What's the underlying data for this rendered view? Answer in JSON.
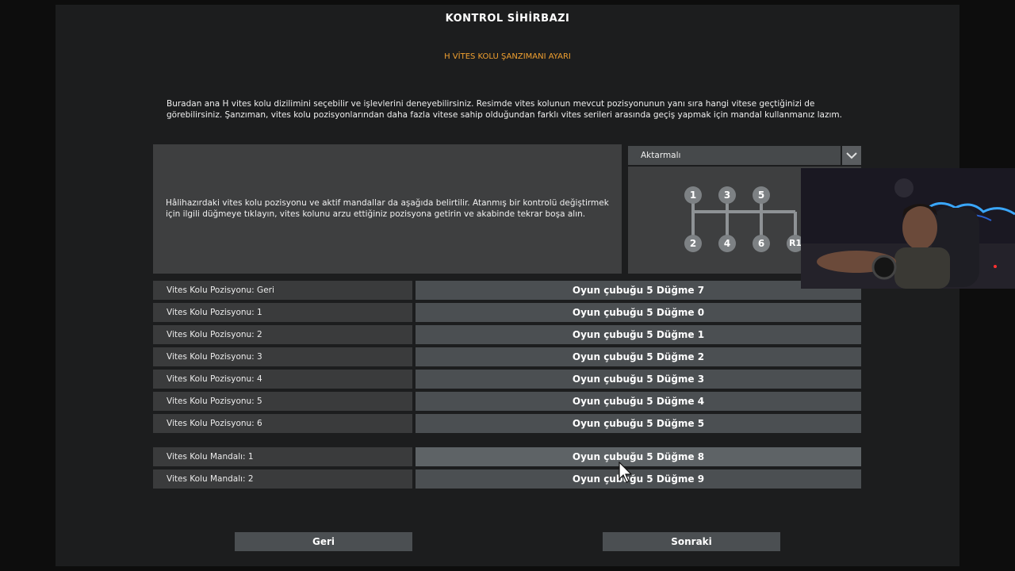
{
  "header": {
    "title": "KONTROL SİHİRBAZI",
    "subtitle": "H VİTES KOLU ŞANZIMANI AYARI"
  },
  "description": "Buradan ana H vites kolu dizilimini seçebilir ve işlevlerini deneyebilirsiniz. Resimde vites kolunun mevcut pozisyonunun yanı sıra hangi vitese geçtiğinizi de görebilirsiniz. Şanzıman, vites kolu pozisyonlarından daha fazla vitese sahip olduğundan farklı vites serileri arasında geçiş yapmak için mandal kullanmanız lazım.",
  "info_text": "Hâlihazırdaki vites kolu pozisyonu ve aktif mandallar da aşağıda belirtilir. Atanmış bir kontrolü değiştirmek için ilgili düğmeye tıklayın, vites kolunu arzu ettiğiniz pozisyona getirin ve akabinde tekrar boşa alın.",
  "gearbox": {
    "selected": "Aktarmalı",
    "gears": [
      "1",
      "3",
      "5",
      "2",
      "4",
      "6",
      "R1"
    ]
  },
  "bindings": [
    {
      "label": "Vites Kolu Pozisyonu: Geri",
      "value": "Oyun çubuğu 5 Düğme 7"
    },
    {
      "label": "Vites Kolu Pozisyonu: 1",
      "value": "Oyun çubuğu 5 Düğme 0"
    },
    {
      "label": "Vites Kolu Pozisyonu: 2",
      "value": "Oyun çubuğu 5 Düğme 1"
    },
    {
      "label": "Vites Kolu Pozisyonu: 3",
      "value": "Oyun çubuğu 5 Düğme 2"
    },
    {
      "label": "Vites Kolu Pozisyonu: 4",
      "value": "Oyun çubuğu 5 Düğme 3"
    },
    {
      "label": "Vites Kolu Pozisyonu: 5",
      "value": "Oyun çubuğu 5 Düğme 4"
    },
    {
      "label": "Vites Kolu Pozisyonu: 6",
      "value": "Oyun çubuğu 5 Düğme 5"
    }
  ],
  "splitters": [
    {
      "label": "Vites Kolu Mandalı: 1",
      "value": "Oyun çubuğu 5 Düğme 8"
    },
    {
      "label": "Vites Kolu Mandalı: 2",
      "value": "Oyun çubuğu 5 Düğme 9"
    }
  ],
  "nav": {
    "back_label": "Geri",
    "next_label": "Sonraki"
  },
  "colors": {
    "accent": "#f0a030",
    "panel": "#1c1d1e",
    "button": "#4b4f52"
  }
}
